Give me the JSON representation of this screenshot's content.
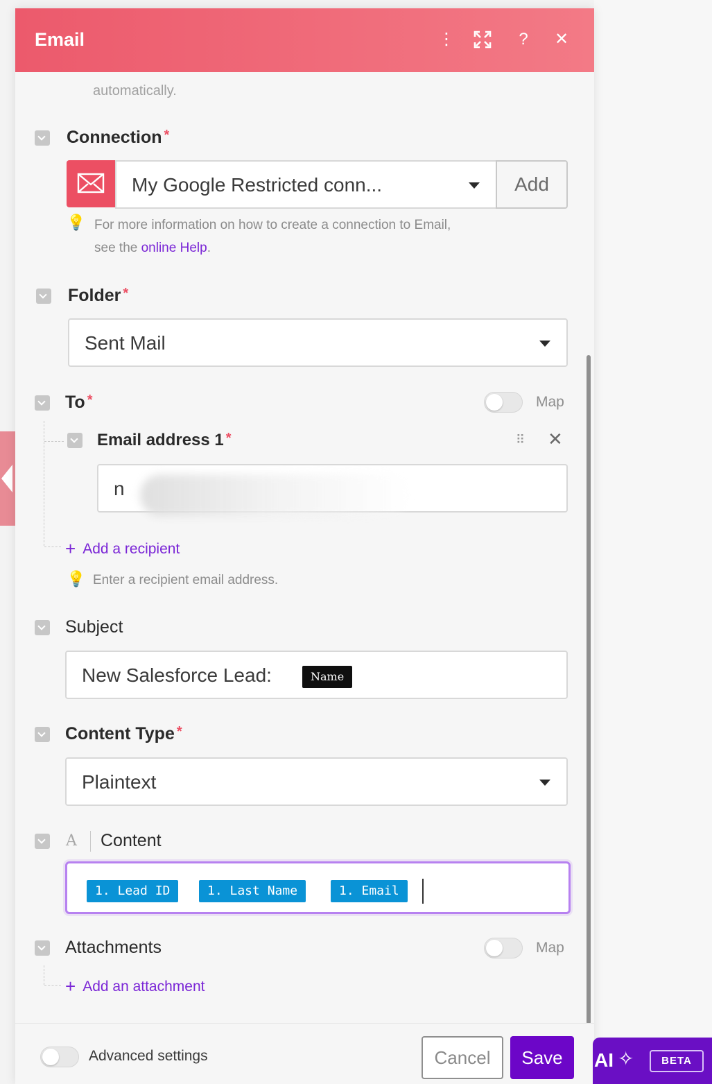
{
  "header": {
    "title": "Email",
    "icons": [
      "more-vertical-icon",
      "expand-icon",
      "help-icon",
      "close-icon"
    ]
  },
  "intro_text": "automatically.",
  "connection": {
    "label": "Connection",
    "required_mark": "*",
    "selected": "My Google Restricted conn...",
    "add_label": "Add",
    "hint_prefix": "For more information on how to create a connection to Email,",
    "hint_see": "see the",
    "hint_link": "online Help",
    "hint_suffix": "."
  },
  "folder": {
    "label": "Folder",
    "required_mark": "*",
    "selected": "Sent Mail"
  },
  "to": {
    "label": "To",
    "required_mark": "*",
    "map_label": "Map",
    "email1_label": "Email address 1",
    "email1_required_mark": "*",
    "email1_value_visible": "n",
    "add_recipient": "Add a recipient",
    "hint": "Enter a recipient email address."
  },
  "subject": {
    "label": "Subject",
    "value_prefix": "New Salesforce Lead:",
    "pill": "Name"
  },
  "content_type": {
    "label": "Content Type",
    "required_mark": "*",
    "selected": "Plaintext"
  },
  "content": {
    "label": "Content",
    "format_glyph": "A",
    "chips": [
      "1. Lead ID",
      "1. Last Name",
      "1. Email"
    ]
  },
  "attachments": {
    "label": "Attachments",
    "map_label": "Map",
    "add_attachment": "Add an attachment"
  },
  "footer": {
    "advanced_settings": "Advanced settings",
    "cancel": "Cancel",
    "save": "Save"
  },
  "ai_bar": {
    "label": "AI",
    "badge": "BETA"
  },
  "colors": {
    "header_start": "#ec5a6c",
    "header_end": "#f37a86",
    "accent_purple": "#6c06c8",
    "link_purple": "#7a25d6",
    "required_red": "#ec4f63",
    "chip_blue": "#0a93d6"
  }
}
